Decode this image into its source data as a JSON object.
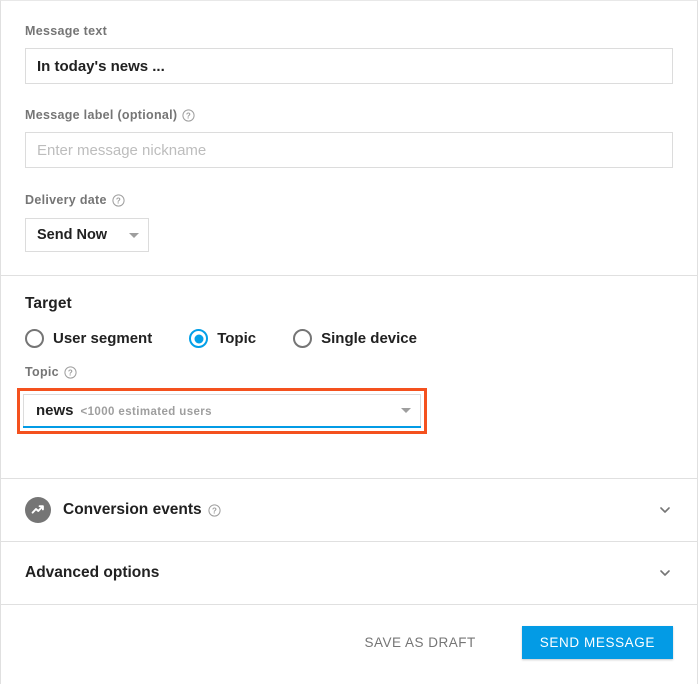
{
  "message_text": {
    "label": "Message text",
    "value": "In today's news ..."
  },
  "message_label": {
    "label": "Message label (optional)",
    "help_icon": "help-circle-icon",
    "placeholder": "Enter message nickname",
    "value": ""
  },
  "delivery_date": {
    "label": "Delivery date",
    "help_icon": "help-circle-icon",
    "selected": "Send Now",
    "caret_icon": "caret-down-icon"
  },
  "target": {
    "title": "Target",
    "options": [
      {
        "label": "User segment",
        "selected": false
      },
      {
        "label": "Topic",
        "selected": true
      },
      {
        "label": "Single device",
        "selected": false
      }
    ],
    "topic_field": {
      "label": "Topic",
      "help_icon": "help-circle-icon",
      "name": "news",
      "estimate": "<1000 estimated users",
      "caret_icon": "caret-down-icon",
      "highlight_color": "#f4511e",
      "underline_color": "#039be5"
    }
  },
  "conversion_events": {
    "title": "Conversion events",
    "icon": "analytics-trending-up-icon",
    "help_icon": "help-circle-icon",
    "chevron_icon": "chevron-down-icon"
  },
  "advanced_options": {
    "title": "Advanced options",
    "chevron_icon": "chevron-down-icon"
  },
  "footer": {
    "save_draft_label": "SAVE AS DRAFT",
    "send_label": "SEND MESSAGE",
    "accent_color": "#039be5"
  }
}
